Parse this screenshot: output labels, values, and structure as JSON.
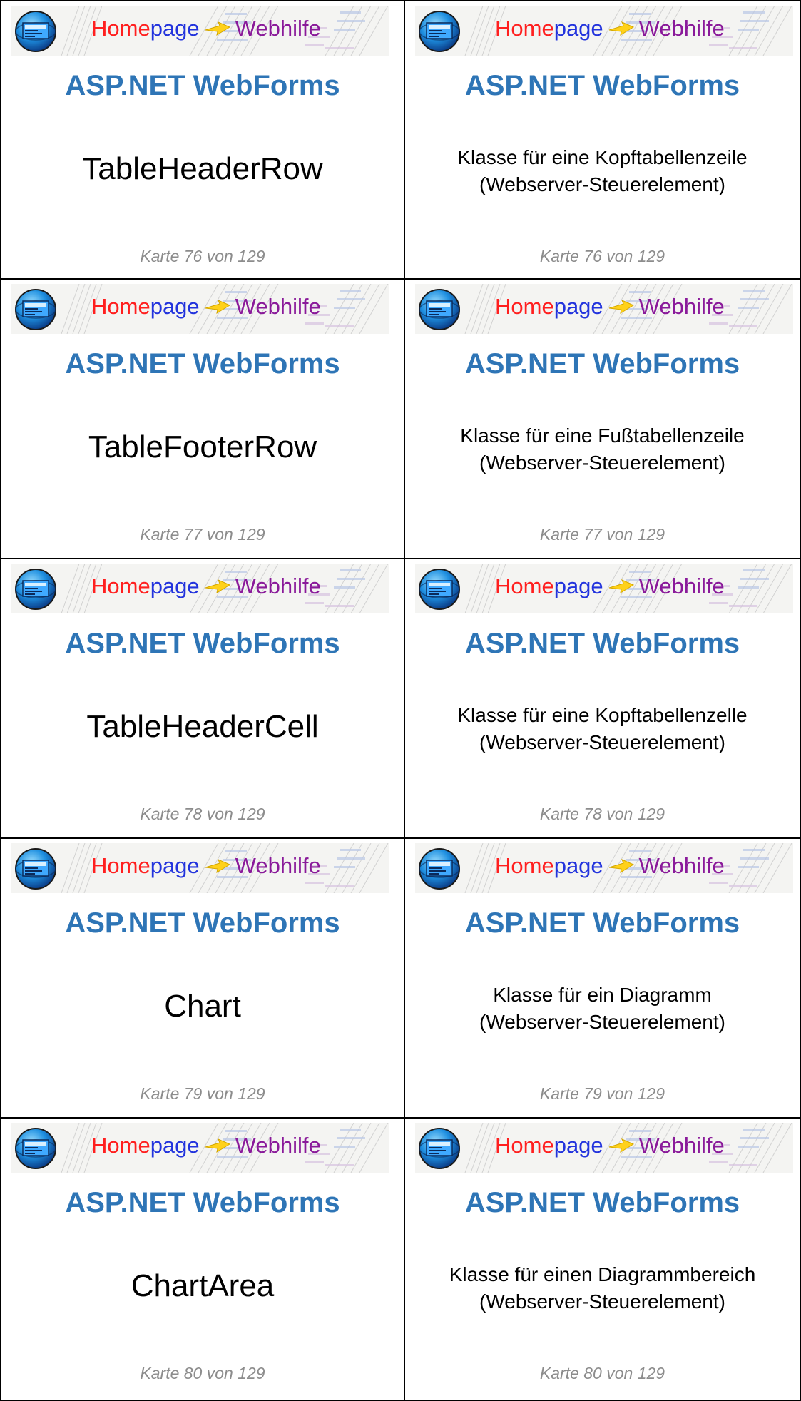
{
  "banner": {
    "home_part_a": "Home",
    "home_part_b": "page",
    "web_text": "Webhilfe",
    "logo_icon": "globe-monitor-icon",
    "arrow_icon": "yellow-arrow-icon",
    "colors": {
      "home_a": "#ff1f1f",
      "home_b": "#2233dd",
      "web": "#8a1a9a",
      "arrow": "#ffd11a"
    }
  },
  "section_title": "ASP.NET WebForms",
  "accent_color": "#2e75b6",
  "cards": [
    {
      "term": "TableHeaderRow",
      "desc_line1": "Klasse für eine Kopftabellenzeile",
      "desc_line2": "(Webserver-Steuerelement)",
      "footer": "Karte 76 von 129"
    },
    {
      "term": "TableFooterRow",
      "desc_line1": "Klasse für eine Fußtabellenzeile",
      "desc_line2": "(Webserver-Steuerelement)",
      "footer": "Karte 77 von 129"
    },
    {
      "term": "TableHeaderCell",
      "desc_line1": "Klasse für eine Kopftabellenzelle",
      "desc_line2": "(Webserver-Steuerelement)",
      "footer": "Karte 78 von 129"
    },
    {
      "term": "Chart",
      "desc_line1": "Klasse für ein Diagramm",
      "desc_line2": "(Webserver-Steuerelement)",
      "footer": "Karte 79 von 129"
    },
    {
      "term": "ChartArea",
      "desc_line1": "Klasse für einen Diagrammbereich",
      "desc_line2": "(Webserver-Steuerelement)",
      "footer": "Karte 80 von 129"
    }
  ]
}
